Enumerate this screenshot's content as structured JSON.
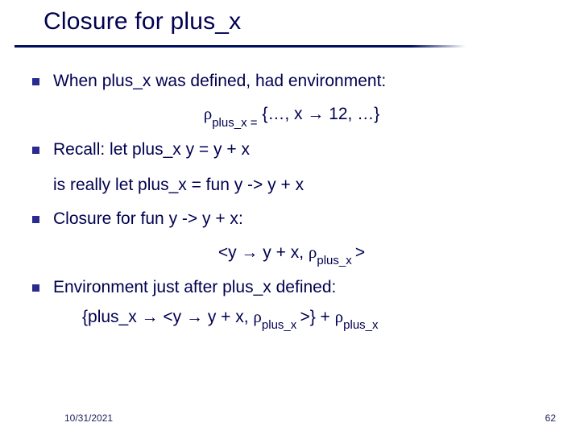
{
  "title": "Closure for plus_x",
  "bullets": {
    "b1": "When plus_x was defined, had environment:",
    "env_pre": "ρ",
    "env_sub": "plus_x =",
    "env_post": " {…, x → 12, …}",
    "b2_pre": "Recall: ",
    "b2_code": "let plus_x y = y + x",
    "is_really_pre": "is really ",
    "is_really_code": "let plus_x = fun y -> y + x",
    "b3_pre": "Closure for ",
    "b3_code": "fun y -> y + x",
    "b3_post": ":",
    "closure_pre": "<y → y + x, ",
    "closure_rho": "ρ",
    "closure_sub": "plus_x ",
    "closure_post": ">",
    "b4": "Environment just after plus_x defined:",
    "final_a": "{plus_x → <y → y + x, ",
    "final_rho1": "ρ",
    "final_sub1": "plus_x ",
    "final_b": ">} + ",
    "final_rho2": "ρ",
    "final_sub2": "plus_x"
  },
  "footer": {
    "date": "10/31/2021",
    "page": "62"
  }
}
